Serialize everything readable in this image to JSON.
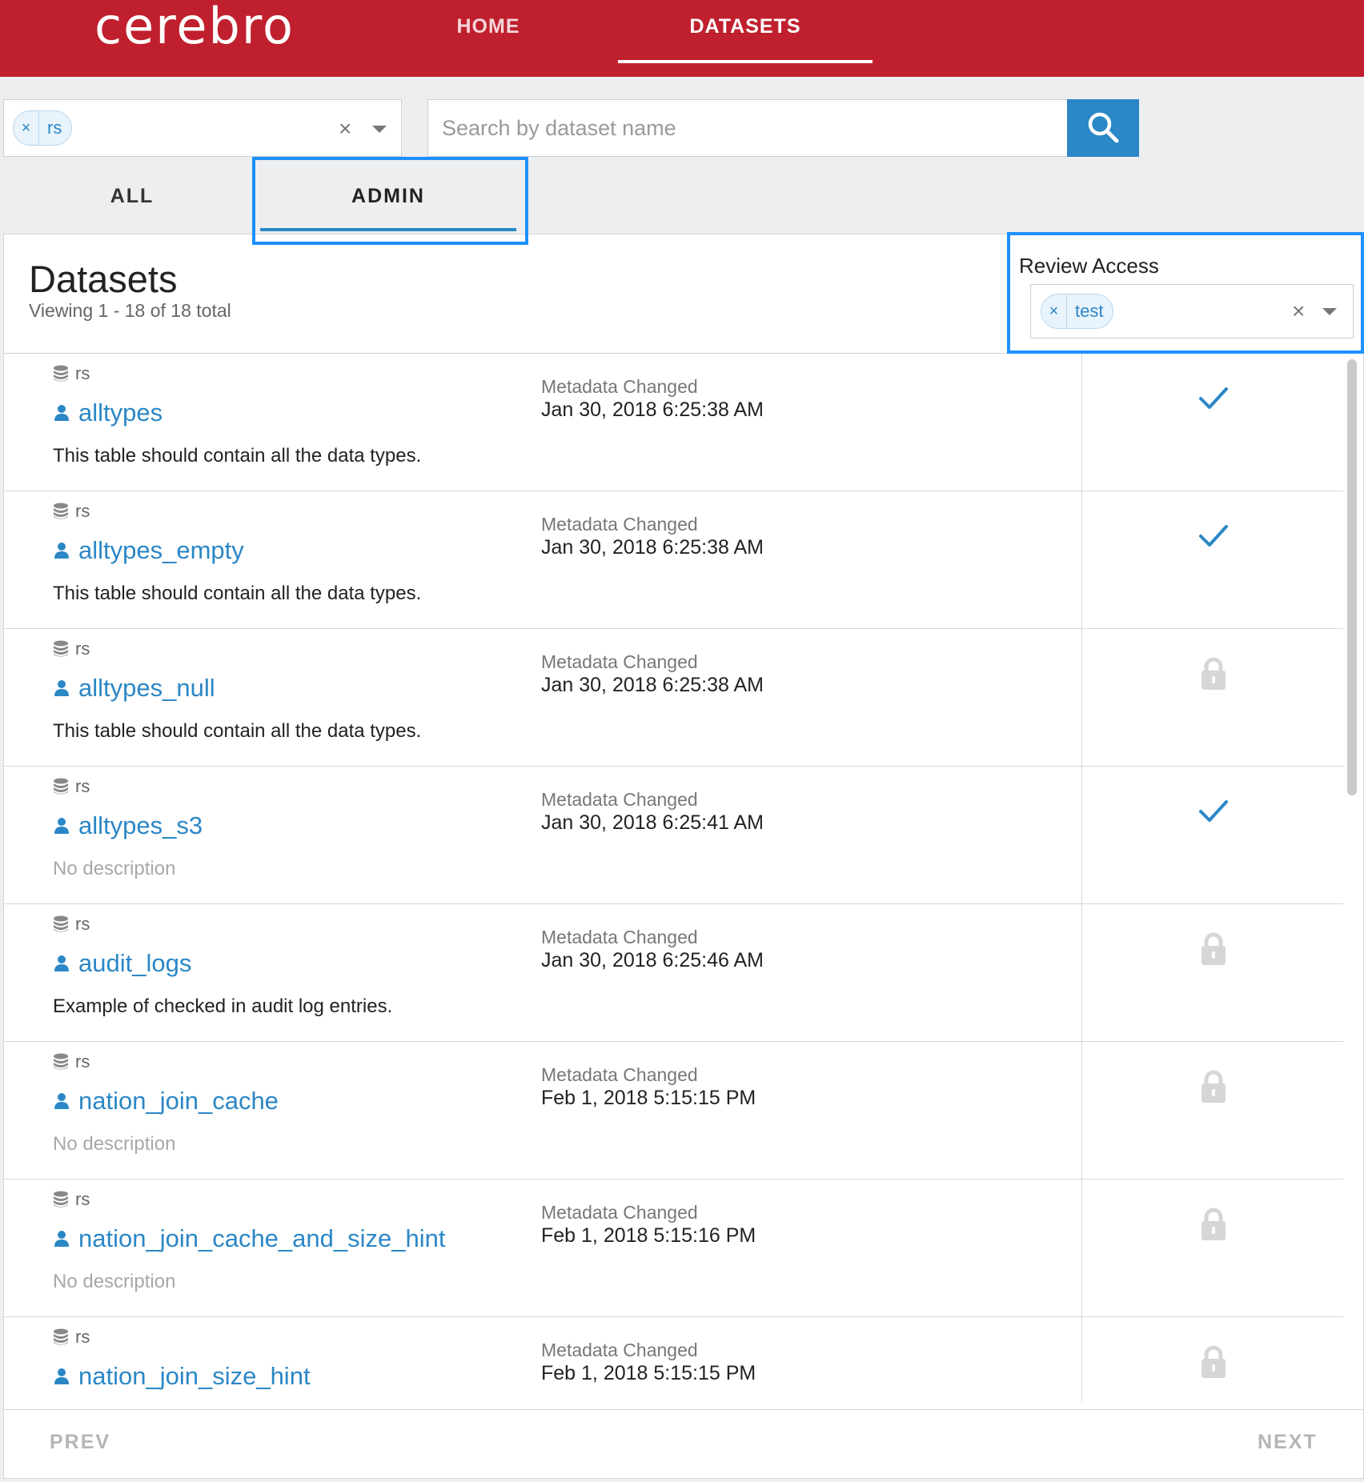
{
  "header": {
    "logo": "cerebro",
    "nav": [
      {
        "label": "HOME"
      },
      {
        "label": "DATASETS"
      }
    ]
  },
  "filter": {
    "database_tag": "rs",
    "clear_symbol": "×",
    "search_placeholder": "Search by dataset name"
  },
  "tabs": [
    {
      "label": "ALL"
    },
    {
      "label": "ADMIN",
      "active": true
    }
  ],
  "panel": {
    "title": "Datasets",
    "subtitle": "Viewing 1 - 18 of 18 total",
    "review_access": {
      "label": "Review Access",
      "tag": "test"
    }
  },
  "datasets": [
    {
      "db": "rs",
      "name": "alltypes",
      "description": "This table should contain all the data types.",
      "meta_label": "Metadata Changed",
      "date": "Jan 30, 2018 6:25:38 AM",
      "status": "check"
    },
    {
      "db": "rs",
      "name": "alltypes_empty",
      "description": "This table should contain all the data types.",
      "meta_label": "Metadata Changed",
      "date": "Jan 30, 2018 6:25:38 AM",
      "status": "check"
    },
    {
      "db": "rs",
      "name": "alltypes_null",
      "description": "This table should contain all the data types.",
      "meta_label": "Metadata Changed",
      "date": "Jan 30, 2018 6:25:38 AM",
      "status": "lock"
    },
    {
      "db": "rs",
      "name": "alltypes_s3",
      "description": "No description",
      "meta_label": "Metadata Changed",
      "date": "Jan 30, 2018 6:25:41 AM",
      "status": "check"
    },
    {
      "db": "rs",
      "name": "audit_logs",
      "description": "Example of checked in audit log entries.",
      "meta_label": "Metadata Changed",
      "date": "Jan 30, 2018 6:25:46 AM",
      "status": "lock"
    },
    {
      "db": "rs",
      "name": "nation_join_cache",
      "description": "No description",
      "meta_label": "Metadata Changed",
      "date": "Feb 1, 2018 5:15:15 PM",
      "status": "lock"
    },
    {
      "db": "rs",
      "name": "nation_join_cache_and_size_hint",
      "description": "No description",
      "meta_label": "Metadata Changed",
      "date": "Feb 1, 2018 5:15:16 PM",
      "status": "lock"
    },
    {
      "db": "rs",
      "name": "nation_join_size_hint",
      "description": "",
      "meta_label": "Metadata Changed",
      "date": "Feb 1, 2018 5:15:15 PM",
      "status": "lock"
    }
  ],
  "pagination": {
    "prev": "PREV",
    "next": "NEXT"
  },
  "colors": {
    "brand": "#c0202e",
    "accent": "#2b87c5",
    "highlight": "#1e90ff"
  }
}
